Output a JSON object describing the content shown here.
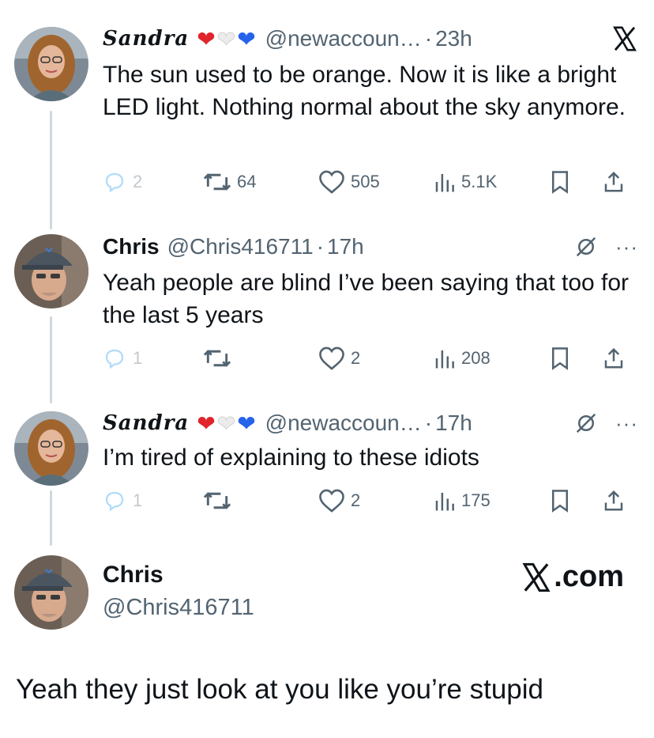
{
  "tweets": [
    {
      "name": "Sandra",
      "hearts": [
        "❤",
        "❤",
        "❤"
      ],
      "handle": "@newaccoun…",
      "dot": "·",
      "time": "23h",
      "text": "The sun used to be orange. Now it is like a bright LED light. Nothing normal about the sky anymore.",
      "replies": "2",
      "reposts": "64",
      "likes": "505",
      "views": "5.1K"
    },
    {
      "name": "Chris",
      "handle": "@Chris416711",
      "dot": "·",
      "time": "17h",
      "more": "···",
      "text": "Yeah people are blind I’ve been saying that too for the last 5 years",
      "replies": "1",
      "reposts": "",
      "likes": "2",
      "views": "208"
    },
    {
      "name": "Sandra",
      "hearts": [
        "❤",
        "❤",
        "❤"
      ],
      "handle": "@newaccoun…",
      "dot": "·",
      "time": "17h",
      "more": "···",
      "text": "I’m tired of explaining to these idiots",
      "replies": "1",
      "reposts": "",
      "likes": "2",
      "views": "175"
    }
  ],
  "focus_tweet": {
    "name": "Chris",
    "handle": "@Chris416711",
    "brand": ".com",
    "text": "Yeah they just look at you like you’re stupid"
  },
  "colors": {
    "text": "#0f1419",
    "secondary": "#536471",
    "thread_line": "#cfd9de",
    "heart_red": "#e0242a",
    "heart_blue": "#2563eb"
  }
}
